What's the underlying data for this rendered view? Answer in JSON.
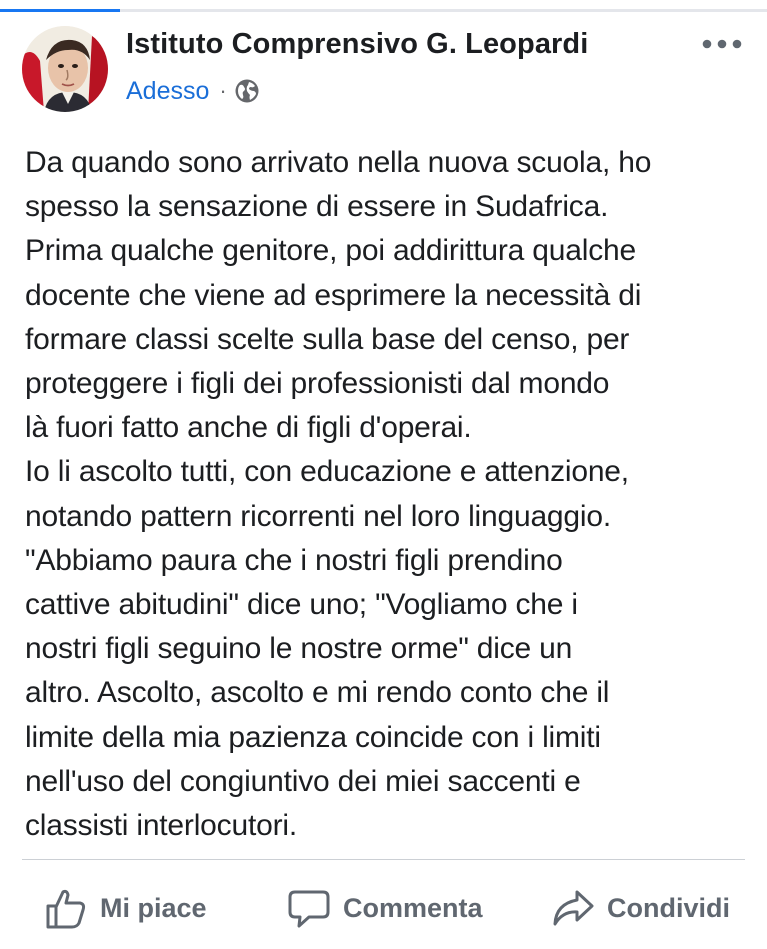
{
  "post": {
    "author": "Istituto Comprensivo G. Leopardi",
    "timestamp": "Adesso",
    "separator": "·",
    "privacy_icon": "globe-icon",
    "more_icon": "more-options-icon",
    "body": "Da quando sono arrivato nella nuova scuola, ho\nspesso la sensazione di essere in Sudafrica.\nPrima qualche genitore, poi addirittura qualche\ndocente che viene ad esprimere la necessità di\nformare classi scelte sulla base del censo, per\nproteggere i figli dei professionisti dal mondo\nlà fuori  fatto anche di figli d'operai.\nIo li ascolto tutti, con educazione e attenzione,\nnotando pattern ricorrenti nel loro linguaggio.\n\"Abbiamo paura che i nostri figli prendino\ncattive abitudini\" dice uno; \"Vogliamo che i\nnostri figli seguino le nostre orme\" dice un\naltro. Ascolto, ascolto e mi rendo conto che il\nlimite della mia pazienza coincide con i limiti\nnell'uso del congiuntivo dei miei saccenti e\nclassisti interlocutori."
  },
  "actions": {
    "like": {
      "label": "Mi piace",
      "icon": "thumbs-up-icon"
    },
    "comment": {
      "label": "Commenta",
      "icon": "comment-bubble-icon"
    },
    "share": {
      "label": "Condividi",
      "icon": "share-arrow-icon"
    }
  },
  "colors": {
    "accent": "#1877f2",
    "timestamp": "#1a6ed8",
    "action_text": "#606770",
    "body_text": "#1c1e21"
  }
}
